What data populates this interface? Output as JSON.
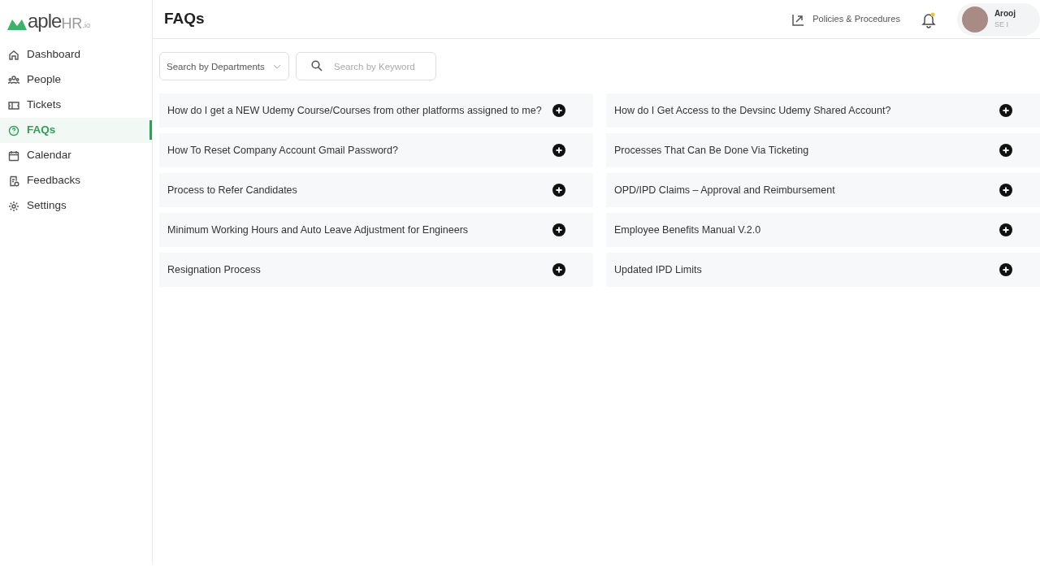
{
  "logo": {
    "text": "aple",
    "suffix": "HR",
    "tld": ".io"
  },
  "sidebar": {
    "items": [
      {
        "label": "Dashboard",
        "kind": "home",
        "selected": false
      },
      {
        "label": "People",
        "kind": "people",
        "selected": false
      },
      {
        "label": "Tickets",
        "kind": "ticket",
        "selected": false
      },
      {
        "label": "FAQs",
        "kind": "question",
        "selected": true
      },
      {
        "label": "Calendar",
        "kind": "calendar",
        "selected": false
      },
      {
        "label": "Feedbacks",
        "kind": "feedback",
        "selected": false
      },
      {
        "label": "Settings",
        "kind": "gear",
        "selected": false
      }
    ]
  },
  "header": {
    "title": "FAQs",
    "link": "Policies & Procedures",
    "user": {
      "name": "Arooj",
      "role": "SE I"
    }
  },
  "filters": {
    "department": {
      "placeholder": "Search by Departments"
    },
    "keyword": {
      "placeholder": "Search by Keyword"
    }
  },
  "faqs": [
    {
      "question": "How do I get a NEW Udemy Course/Courses from other platforms assigned to me?",
      "expanded": false
    },
    {
      "question": "How do I Get Access to the Devsinc Udemy Shared Account?",
      "expanded": false
    },
    {
      "question": "How To Reset Company Account Gmail Password?",
      "expanded": false
    },
    {
      "question": "Processes That Can Be Done Via Ticketing",
      "expanded": false
    },
    {
      "question": "Process to Refer Candidates",
      "expanded": false
    },
    {
      "question": "OPD/IPD Claims – Approval and Reimbursement",
      "expanded": false
    },
    {
      "question": "Minimum Working Hours and Auto Leave Adjustment for Engineers",
      "expanded": false
    },
    {
      "question": "Employee Benefits Manual V.2.0",
      "expanded": false
    },
    {
      "question": "Resignation Process",
      "expanded": false
    },
    {
      "question": "Updated IPD Limits",
      "expanded": false
    }
  ]
}
